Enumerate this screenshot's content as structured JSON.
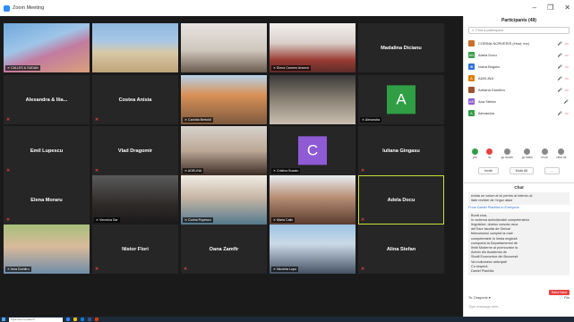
{
  "window": {
    "title": "Zoom Meeting",
    "minimize": "–",
    "restore": "❐",
    "close": "✕"
  },
  "tiles": [
    {
      "name": "",
      "label": "CALLES & SUDAN",
      "photo": "city",
      "avatar": null,
      "muted": false
    },
    {
      "name": "",
      "label": "",
      "photo": "building",
      "avatar": null,
      "muted": false
    },
    {
      "name": "",
      "label": "",
      "photo": "person-glasses",
      "avatar": null,
      "muted": false
    },
    {
      "name": "",
      "label": "Elena Carmen Arsenoi",
      "photo": "person-red",
      "avatar": null,
      "muted": false
    },
    {
      "name": "Madalina Dicianu",
      "label": "",
      "photo": null,
      "avatar": null,
      "muted": false
    },
    {
      "name": "Alexandra & Ilia...",
      "label": "",
      "photo": null,
      "avatar": null,
      "muted": true
    },
    {
      "name": "Costea Anisia",
      "label": "",
      "photo": null,
      "avatar": null,
      "muted": true
    },
    {
      "name": "",
      "label": "Carlotta Bertoldi",
      "photo": "person-room",
      "avatar": null,
      "muted": false
    },
    {
      "name": "",
      "label": "",
      "photo": "room-dark",
      "avatar": null,
      "muted": false
    },
    {
      "name": "",
      "label": "Alexandra",
      "photo": null,
      "avatar": {
        "letter": "A",
        "color": "#2f9e44"
      },
      "muted": false
    },
    {
      "name": "Emil Lupescu",
      "label": "",
      "photo": null,
      "avatar": null,
      "muted": true
    },
    {
      "name": "Vlad Dragomir",
      "label": "",
      "photo": null,
      "avatar": null,
      "muted": true
    },
    {
      "name": "",
      "label": "ADELINA",
      "photo": "person-girl",
      "avatar": null,
      "muted": false
    },
    {
      "name": "",
      "label": "Cristina Buzatu",
      "photo": null,
      "avatar": {
        "letter": "C",
        "color": "#8e5bd4"
      },
      "muted": false
    },
    {
      "name": "Iuliana Gingasu",
      "label": "",
      "photo": null,
      "avatar": null,
      "muted": true
    },
    {
      "name": "Elena Moraru",
      "label": "",
      "photo": null,
      "avatar": null,
      "muted": true
    },
    {
      "name": "",
      "label": "Veronica Sar",
      "photo": "person-dark",
      "avatar": null,
      "muted": false
    },
    {
      "name": "",
      "label": "Corina Popescu",
      "photo": "person-bright",
      "avatar": null,
      "muted": false
    },
    {
      "name": "",
      "label": "Maria Calin",
      "photo": "person-window",
      "avatar": null,
      "muted": false
    },
    {
      "name": "Adela Docu",
      "label": "",
      "photo": null,
      "avatar": null,
      "muted": true,
      "active": true
    },
    {
      "name": "",
      "label": "Irina Dumitru",
      "photo": "person-outdoor",
      "avatar": null,
      "muted": false
    },
    {
      "name": "Nistor Flori",
      "label": "",
      "photo": null,
      "avatar": null,
      "muted": true
    },
    {
      "name": "Oana Zamfir",
      "label": "",
      "photo": null,
      "avatar": null,
      "muted": true
    },
    {
      "name": "",
      "label": "Nicoleta Lupu",
      "photo": "person-sky",
      "avatar": null,
      "muted": false
    },
    {
      "name": "Alina Stefan",
      "label": "",
      "photo": null,
      "avatar": null,
      "muted": true
    }
  ],
  "panel": {
    "title": "Participants (49)",
    "search_placeholder": "Find a participant",
    "participants": [
      {
        "name": "CORINA NORVERIS (Host, me)",
        "initial": "",
        "color": "#c96f2b",
        "icons": "🎤 ▭"
      },
      {
        "name": "Adela Docu",
        "initial": "AD",
        "color": "#2f9e44",
        "icons": "🎤 ▭"
      },
      {
        "name": "Ioana Bogatu",
        "initial": "IB",
        "color": "#2d6fd6",
        "icons": "🎤 ▭"
      },
      {
        "name": "ADELINA",
        "initial": "A",
        "color": "#e07b00",
        "icons": "🎤 ▭"
      },
      {
        "name": "Adriana Dumitriu",
        "initial": "",
        "color": "#a0522d",
        "icons": "🎤 ▭"
      },
      {
        "name": "Ana Stefan",
        "initial": "AS",
        "color": "#8e5bd4",
        "icons": "🎤"
      },
      {
        "name": "Alexandra",
        "initial": "A",
        "color": "#2f9e44",
        "icons": "🎤 ▭"
      }
    ],
    "actions": [
      {
        "label": "yes",
        "color": "#2f9e44"
      },
      {
        "label": "no",
        "color": "#e84141"
      },
      {
        "label": "go slower",
        "color": "#888"
      },
      {
        "label": "go faster",
        "color": "#888"
      },
      {
        "label": "more",
        "color": "#888"
      },
      {
        "label": "clear all",
        "color": "#888"
      }
    ],
    "invite_label": "Invite",
    "mute_all_label": "Mute All",
    "more_label": "...",
    "chat_title": "Chat",
    "chat_from_1": "From Daniel Plachita to Everyone:",
    "chat_text_0": "exista un volum al lui pentru al interviu al\nitate revistei de l ingur ataul",
    "chat_text_1": "Bună ziua,\nîn vederea achiziționării competențelor\nlingvistice, doresc cursula osca\ndelTutur faculta de Ginica!\nfelecuimului complet la maii\ncompetentele în limba engleză\nconsporta la Departamentul de\nlimbi Moderne ai promovator la\nAdmin din Academia de\nStudii Economice din București\nVa mulțumesc anticipat!\nCu respect,\nDaniel Plachita",
    "chat_to_label": "To: Dragomir ▾",
    "file_label": "📄 File",
    "chat_input_placeholder": "Type message here...",
    "more_button": "Raise hand"
  },
  "taskbar": {
    "search_placeholder": "Type here to search"
  }
}
